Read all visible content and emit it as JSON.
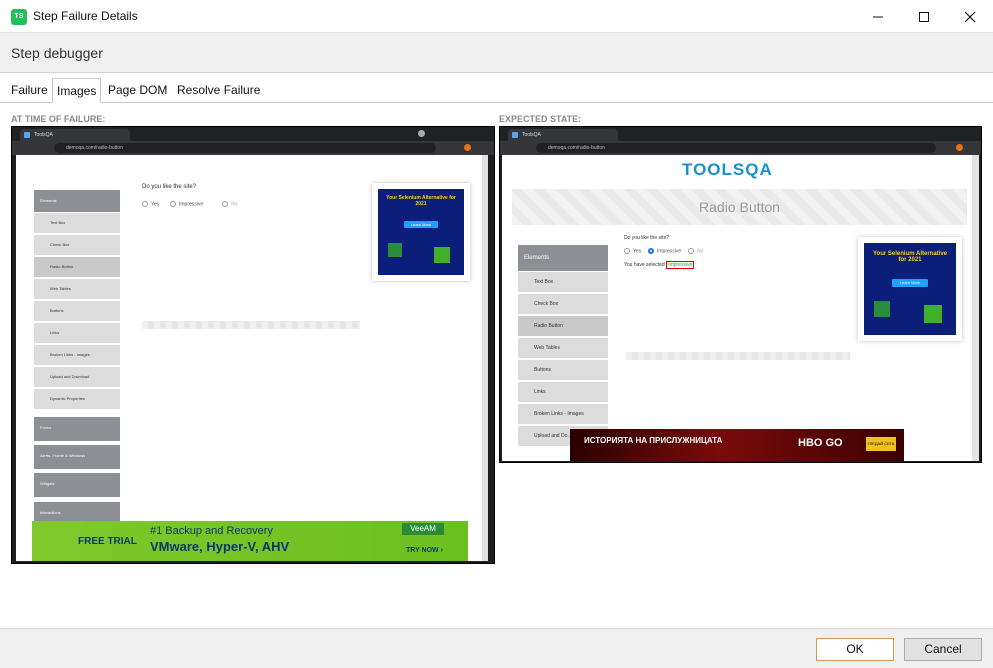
{
  "window": {
    "title": "Step Failure Details",
    "app_icon": "TS"
  },
  "header": {
    "title": "Step debugger"
  },
  "tabs": [
    {
      "label": "Failure"
    },
    {
      "label": "Images",
      "active": true
    },
    {
      "label": "Page DOM"
    },
    {
      "label": "Resolve Failure"
    }
  ],
  "left_panel": {
    "label": "AT TIME OF FAILURE:",
    "browser": {
      "tab_title": "ToolsQA",
      "url": "demoqa.com/radio-button"
    },
    "question": "Do you like the site?",
    "options": [
      "Yes",
      "Impressive",
      "No"
    ],
    "sidebar_group": "Elements",
    "sidebar_items": [
      "Text Box",
      "Check Box",
      "Radio Button",
      "Web Tables",
      "Buttons",
      "Links",
      "Broken Links - Images",
      "Upload and Download",
      "Dynamic Properties"
    ],
    "collapsed_groups": [
      "Forms",
      "Alerts, Frame & Windows",
      "Widgets",
      "Interactions"
    ],
    "ad": {
      "title": "Your Selenium Alternative for 2021",
      "button": "Learn More"
    },
    "bottom_ad": {
      "trial": "FREE TRIAL",
      "line1": "#1 Backup and Recovery",
      "line2": "VMware, Hyper-V, AHV",
      "brand": "VeeAM",
      "cta": "TRY NOW ›"
    }
  },
  "right_panel": {
    "label": "EXPECTED STATE:",
    "browser": {
      "tab_title": "ToolsQA",
      "url": "demoqa.com/radio-button"
    },
    "logo": "TOOLSQA",
    "banner": "Radio Button",
    "question": "Do you like the site?",
    "options": [
      "Yes",
      "Impressive",
      "No"
    ],
    "result_prefix": "You have selected",
    "result_value": "Impressive",
    "sidebar_group": "Elements",
    "sidebar_items": [
      "Text Box",
      "Check Box",
      "Radio Button",
      "Web Tables",
      "Buttons",
      "Links",
      "Broken Links - Images",
      "Upload and Do..."
    ],
    "ad": {
      "title": "Your Selenium Alternative for 2021",
      "button": "Learn More"
    },
    "bottom_ad": {
      "text": "ИСТОРИЯТА НА ПРИСЛУЖНИЦАТА",
      "brand": "HBO GO",
      "cta": "ГЛЕДАЙ СЕГА"
    }
  },
  "footer": {
    "ok_label": "OK",
    "cancel_label": "Cancel"
  },
  "colors": {
    "accent_green": "#21c05a",
    "ok_border": "#d89a52",
    "ad_navy": "#0b1e7a",
    "ad_yellow": "#ffd200"
  }
}
